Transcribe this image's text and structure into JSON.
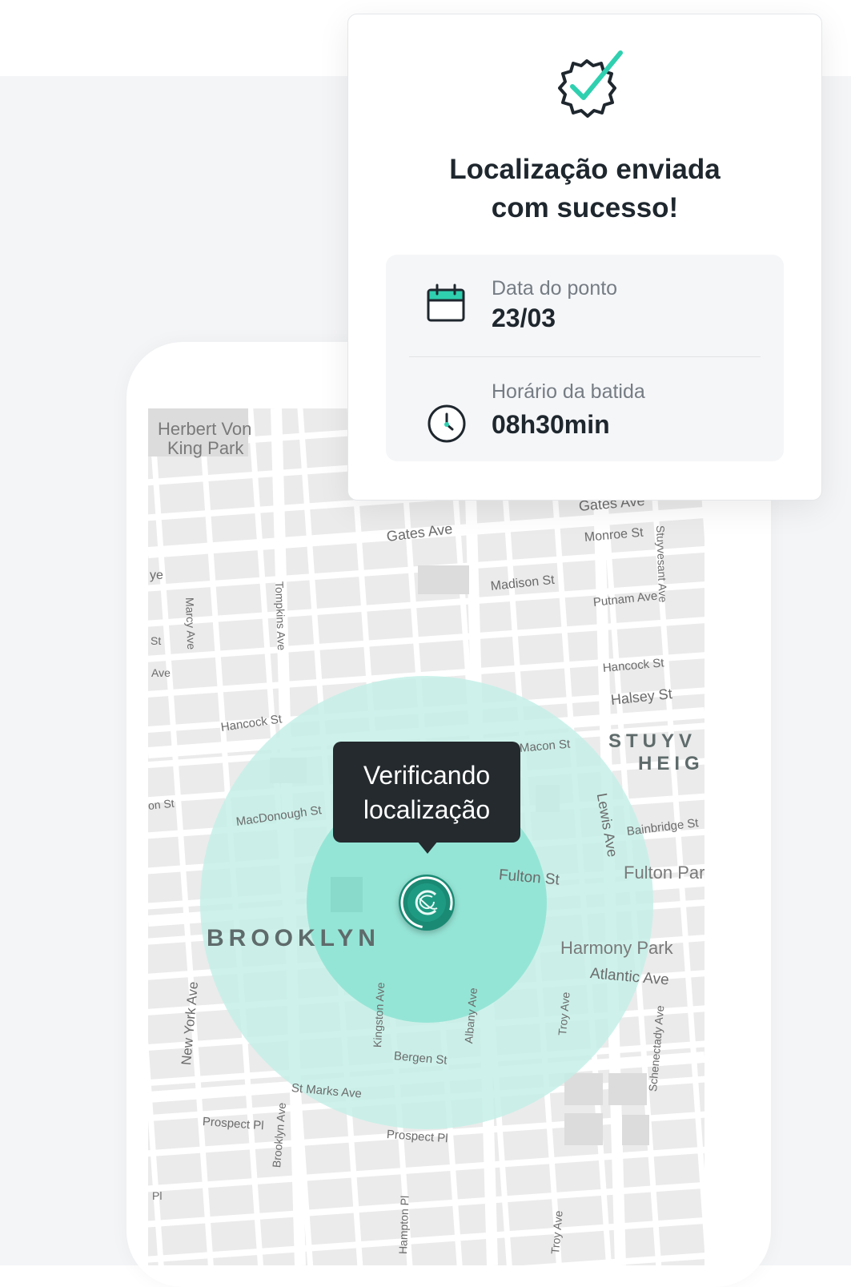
{
  "confirmation": {
    "title_line1": "Localização enviada",
    "title_line2": "com sucesso!",
    "date_label": "Data do ponto",
    "date_value": "23/03",
    "time_label": "Horário da batida",
    "time_value": "08h30min",
    "accent_color": "#2fd0b0",
    "icons": [
      "gear-check-icon",
      "calendar-icon",
      "clock-icon"
    ]
  },
  "map": {
    "tooltip_line1": "Verificando",
    "tooltip_line2": "localização",
    "district": "BROOKLYN",
    "district2_line1": "STUYV",
    "district2_line2": "HEIG",
    "areas": {
      "herbert_line1": "Herbert Von",
      "herbert_line2": "King Park",
      "harmony": "Harmony Park",
      "fulton_park": "Fulton Par"
    },
    "streets": {
      "gates_ave": "Gates Ave",
      "gates_ave_2": "Gates Ave",
      "monroe_st": "Monroe St",
      "stuyvesant_ave": "Stuyvesant Ave",
      "madison_st": "Madison St",
      "putnam_ave": "Putnam Ave",
      "tompkins_ave": "Tompkins Ave",
      "marcy_ave": "Marcy Ave",
      "hancock_st": "Hancock St",
      "hancock_st_2": "Hancock St",
      "halsey_st": "Halsey St",
      "macon_st": "Macon St",
      "macdonough_st": "MacDonough St",
      "lewis_ave": "Lewis Ave",
      "bainbridge_st": "Bainbridge St",
      "fulton_st": "Fulton St",
      "atlantic_ave": "Atlantic Ave",
      "new_york_ave": "New York Ave",
      "kingston_ave": "Kingston Ave",
      "albany_ave": "Albany Ave",
      "troy_ave": "Troy Ave",
      "troy_ave_2": "Troy Ave",
      "schenectady_ave": "Schenectady Ave",
      "bergen_st": "Bergen St",
      "st_marks_ave": "St Marks Ave",
      "brooklyn_ave": "Brooklyn Ave",
      "prospect_pl": "Prospect Pl",
      "prospect_pl_2": "Prospect Pl",
      "hampton_pl": "Hampton Pl",
      "pl": "Pl",
      "frag_ye": "ye",
      "frag_st": "St",
      "frag_ave": "Ave",
      "frag_on_st": "on St"
    },
    "colors": {
      "outer_circle": "#c3efe6",
      "inner_circle": "#8fe3d4",
      "pin": "#1a8a74",
      "tooltip_bg": "#242a2e"
    }
  }
}
